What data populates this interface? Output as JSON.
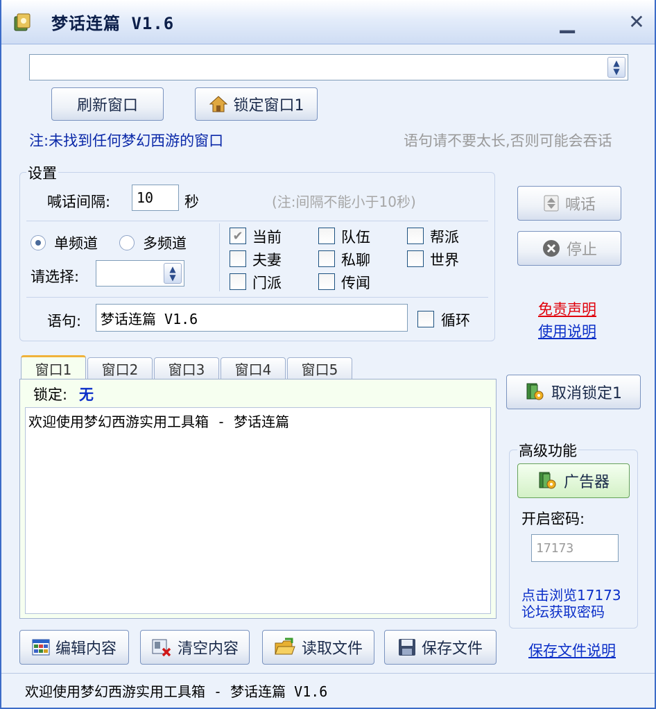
{
  "window": {
    "title": "梦话连篇  V1.6",
    "minimize_label": "▁",
    "close_label": "✕"
  },
  "top": {
    "window_select_value": "",
    "refresh_label": "刷新窗口",
    "lock_label": "锁定窗口1",
    "note_left": "注:未找到任何梦幻西游的窗口",
    "note_right": "语句请不要太长,否则可能会吞话"
  },
  "settings": {
    "group_label": "设置",
    "interval_label": "喊话间隔:",
    "interval_value": "10",
    "interval_unit": "秒",
    "interval_note": "(注:间隔不能小于10秒)",
    "single_channel": "单频道",
    "multi_channel": "多频道",
    "select_label": "请选择:",
    "select_value": "",
    "channels": {
      "current": "当前",
      "team": "队伍",
      "gang": "帮派",
      "couple": "夫妻",
      "private": "私聊",
      "world": "世界",
      "sect": "门派",
      "rumor": "传闻"
    },
    "sentence_label": "语句:",
    "sentence_value": "梦话连篇 V1.6",
    "loop_label": "循环"
  },
  "right": {
    "shout_label": "喊话",
    "stop_label": "停止",
    "disclaimer_link": "免责声明",
    "usage_link": "使用说明",
    "unlock_label": "取消锁定1",
    "advanced_label": "高级功能",
    "ad_label": "广告器",
    "password_label": "开启密码:",
    "password_value": "17173",
    "browse_link_1": "点击浏览17173",
    "browse_link_2": "论坛获取密码",
    "save_help_link": "保存文件说明"
  },
  "tabs": [
    "窗口1",
    "窗口2",
    "窗口3",
    "窗口4",
    "窗口5"
  ],
  "panel": {
    "lock_label": "锁定:",
    "lock_value": "无",
    "log_text": "欢迎使用梦幻西游实用工具箱 - 梦话连篇"
  },
  "bottom": {
    "edit_label": "编辑内容",
    "clear_label": "清空内容",
    "read_label": "读取文件",
    "save_label": "保存文件"
  },
  "status": {
    "text": "欢迎使用梦幻西游实用工具箱 - 梦话连篇 V1.6"
  },
  "colors": {
    "red_link": "#e0000a",
    "blue_link": "#0b2fc8",
    "note_blue": "#0a28a8",
    "grey": "#9a9a9a"
  },
  "icons": [
    "app-icon",
    "house-icon",
    "shout-icon",
    "stop-icon",
    "book-gear-icon",
    "grid-icon",
    "card-delete-icon",
    "folder-open-icon",
    "floppy-icon"
  ]
}
